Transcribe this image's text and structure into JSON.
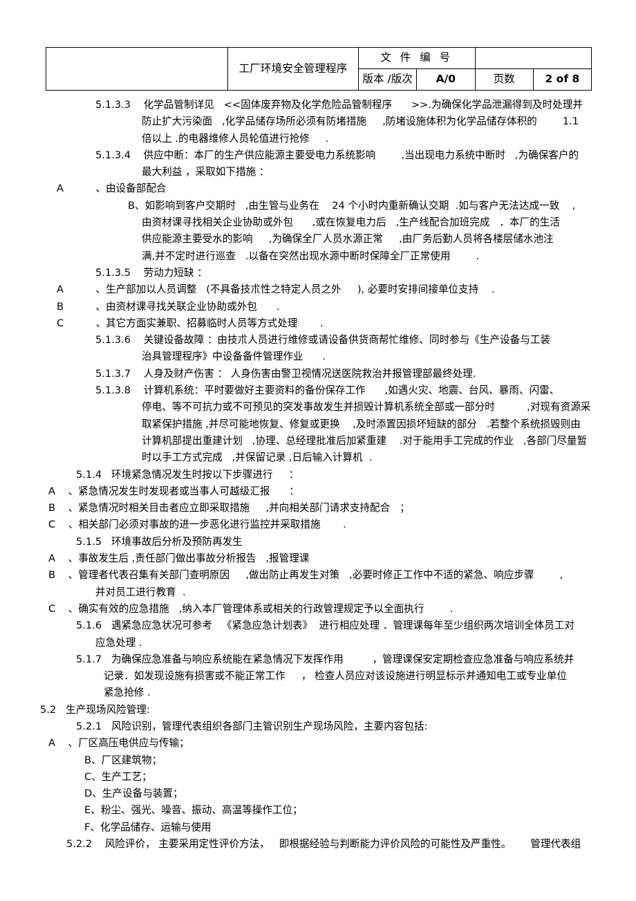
{
  "header": {
    "blank_cell": "",
    "doc_title": "工厂环境安全管理程序",
    "doc_number_label": "文 件 编 号",
    "doc_number_value": "",
    "version_label": "版本 /版次",
    "version_value": "A/0",
    "page_label": "页数",
    "page_value": "2 of 8"
  },
  "body": {
    "lines": [
      {
        "indent": 138,
        "text": "5.1.3.3    化学品管制详见   <<固体废弃物及化学危险品管制程序      >>.为确保化学品泄漏得到及时处理并"
      },
      {
        "indent": 205,
        "text": "防止扩大污染面   ,化学品储存场所必须有防堵措施     ,防堵设施体积为化学品储存体积的        1.1"
      },
      {
        "indent": 205,
        "text": "倍以上 .的电器维修人员轮值进行抢修     ."
      },
      {
        "indent": 138,
        "text": "5.1.3.4    供应中断：本厂的生产供应能源主要受电力系统影响        ,当出现电力系统中断时   ,为确保客户的"
      },
      {
        "indent": 205,
        "text": "最大利益 ，采取如下措施 ："
      },
      {
        "indent": 82,
        "text": "A          、由设备部配合"
      },
      {
        "indent": 185,
        "text": "B、如影响到客户交期时   ,由生管与业务在    24 个小时内重新确认交期  .如与客户无法达成一致    ,"
      },
      {
        "indent": 205,
        "text": "由资材课寻找相关企业协助或外包      ,或在恢复电力后   ,生产线配合加班完成   ．本厂的生活"
      },
      {
        "indent": 205,
        "text": "供应能源主要受水的影响     ,为确保全厂人员水源正常     ,由厂务后勤人员将各楼层储水池注"
      },
      {
        "indent": 205,
        "text": "满,并不定时进行巡查   .以备在突然出现水源中断时保障全厂正常使用        ."
      },
      {
        "indent": 138,
        "text": "5.1.3.5    劳动力短缺 ："
      },
      {
        "indent": 82,
        "text": "A          、生产部加以人员调整   (不具备技朮性之特定人员之外     ), 必要时安排间接单位支持    ."
      },
      {
        "indent": 82,
        "text": "B          、由资材课寻找关联企业协助或外包      ."
      },
      {
        "indent": 82,
        "text": "C          、其它方面实兼职、招募临时人员等方式处理       ."
      },
      {
        "indent": 138,
        "text": "5.1.3.6    关键设备故障 ：由技朮人员进行维修或请设备供货商帮忙维修、同时参与《生产设备与工装"
      },
      {
        "indent": 205,
        "text": "治具管理程序》中设备备件管理作业      ."
      },
      {
        "indent": 138,
        "text": "5.1.3.7    人身及财产伤害 ： 人身伤害由警卫视情况送医院救治并报管理部最终处理."
      },
      {
        "indent": 138,
        "text": "5.1.3.8    计算机系统：平时要做好主要资料的备份保存工作      ,如遇火灾、地震、台风、暴雨、闪雷、"
      },
      {
        "indent": 205,
        "text": "停电、等不可抗力或不可预见的突发事故发生并损毁计算机系统全部或一部分时          ,对现有资源采"
      },
      {
        "indent": 205,
        "text": "取紧保护措施 ,并尽可能地恢复、修复或更换    ,及时添置因损坏短缺的部分   .若整个系统损毁则由"
      },
      {
        "indent": 205,
        "text": "计算机部提出重建计划   ,协理、总经理批准后加紧重建    .对于能用手工完成的作业   ,各部门尽量暂"
      },
      {
        "indent": 205,
        "text": "时以手工方式完成   ,并保留记录 ,日后输入计算机  ."
      },
      {
        "indent": 110,
        "text": "5.1.4   环境紧急情况发生时按以下步骤进行     ："
      },
      {
        "indent": 70,
        "text": "A    、紧急情况发生时发现者或当事人可越级汇报      ："
      },
      {
        "indent": 70,
        "text": "B    、紧急情况时相关目击者应立即采取措施     ,并向相关部门请求支持配合   ；"
      },
      {
        "indent": 70,
        "text": "C    、相关部门必须对事故的进一步恶化进行监控并采取措施       ."
      },
      {
        "indent": 110,
        "text": "5.1.5   环境事故后分析及预防再发生"
      },
      {
        "indent": 70,
        "text": "A    、事故发生后 ,责任部门做出事故分析报告   ,报管理课"
      },
      {
        "indent": 70,
        "text": "B    、管理者代表召集有关部门查明原因     ,做出防止再发生对策   ,必要时修正工作中不适的紧急、响应步骤        ,"
      },
      {
        "indent": 138,
        "text": "并对员工进行教育  ."
      },
      {
        "indent": 70,
        "text": "C    、确实有效的应急措施   ,纳入本厂管理体系或相关的行政管理规定予以全面执行        ."
      },
      {
        "indent": 110,
        "text": "5.1.6   遇紧急应急状况可参考   《紧急应急计划表》  进行相应处理 ．管理课每年至少组织两次培训全体员工对"
      },
      {
        "indent": 138,
        "text": "应急处理 ."
      },
      {
        "indent": 110,
        "text": "5.1.7   为确保应急准备与响应系统能在紧急情况下发挥作用         ，管理课保安定期检查应急准备与响应系统并"
      },
      {
        "indent": 150,
        "text": "记录．如发现设施有损害或不能正常工作     ， 检查人员应对该设施进行明显标示并通知电工或专业单位"
      },
      {
        "indent": 150,
        "text": "紧急抢修 ."
      },
      {
        "indent": 58,
        "text": "5.2   生产现场风险管理:"
      },
      {
        "indent": 110,
        "text": "5.2.1   风险识别，管理代表组织各部门主管识别生产现场风险，主要内容包括:"
      },
      {
        "indent": 70,
        "text": "A    、厂区高压电供应与传输；"
      },
      {
        "indent": 122,
        "text": "B、厂区建筑物；"
      },
      {
        "indent": 122,
        "text": "C、生产工艺；"
      },
      {
        "indent": 122,
        "text": "D、生产设备与装置；"
      },
      {
        "indent": 122,
        "text": "E、粉尘、强光、噪音、振动、高温等操作工位；"
      },
      {
        "indent": 122,
        "text": "F、化学品储存、运输与使用"
      },
      {
        "indent": 96,
        "text": "5.2.2    风险评价， 主要采用定性评价方法，   即根据经验与判断能力评价风险的可能性及严重性。      管理代表组"
      }
    ]
  }
}
